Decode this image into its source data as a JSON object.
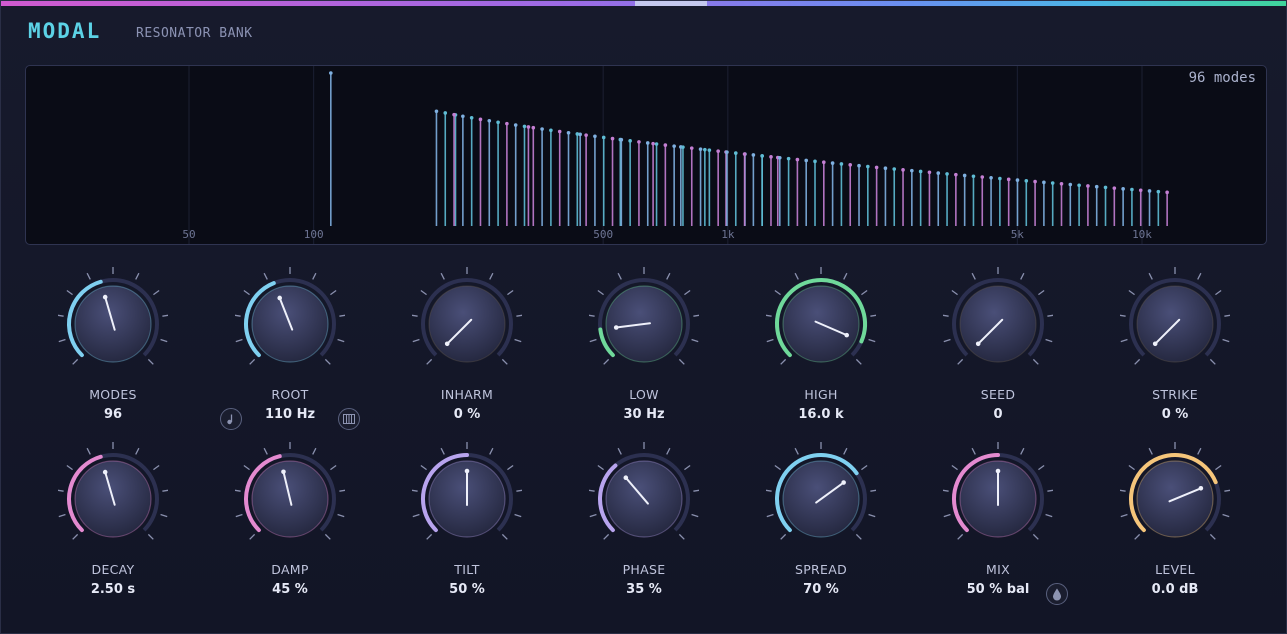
{
  "app": {
    "name": "MODAL",
    "subtitle": "RESONATOR BANK"
  },
  "display": {
    "mode_count_label": "96 modes"
  },
  "chart_data": {
    "type": "bar",
    "x_scale": "log",
    "x_ticks": [
      "50",
      "100",
      "500",
      "1k",
      "5k",
      "10k"
    ],
    "x_tick_values": [
      50,
      100,
      500,
      1000,
      5000,
      10000
    ],
    "xlim": [
      20,
      20000
    ],
    "mode_count": 96,
    "root_hz": 110,
    "upper_hz": 11500,
    "amplitudes": {
      "first": 1.0,
      "last": 0.22
    }
  },
  "colors": {
    "accent": "#5cd2e6",
    "mode_pink": "#c47fd3",
    "mode_blue": "#7fb0e0",
    "mode_cyan": "#5fbcd4",
    "knob_cyan": "#7fd0f0",
    "knob_pink": "#e48ad0",
    "knob_green": "#6fd99a",
    "knob_violet": "#b8a4ee",
    "knob_amber": "#f5c57a"
  },
  "knobs_row1": [
    {
      "id": "modes",
      "label": "MODES",
      "value": "96",
      "norm": 0.44,
      "arc": "#7fd0f0",
      "style": "dir"
    },
    {
      "id": "root",
      "label": "ROOT",
      "value": "110 Hz",
      "norm": 0.42,
      "arc": "#7fd0f0",
      "style": "dir"
    },
    {
      "id": "inharm",
      "label": "INHARM",
      "value": "0 %",
      "norm": 0.0,
      "arc": "none",
      "style": "dir"
    },
    {
      "id": "low",
      "label": "LOW",
      "value": "30 Hz",
      "norm": 0.14,
      "arc": "#6fd99a",
      "style": "dir"
    },
    {
      "id": "high",
      "label": "HIGH",
      "value": "16.0 k",
      "norm": 0.92,
      "arc": "#6fd99a",
      "style": "dir"
    },
    {
      "id": "seed",
      "label": "SEED",
      "value": "0",
      "norm": 0.0,
      "arc": "none",
      "style": "dir"
    },
    {
      "id": "strike",
      "label": "STRIKE",
      "value": "0 %",
      "norm": 0.0,
      "arc": "none",
      "style": "dir"
    }
  ],
  "knobs_row2": [
    {
      "id": "decay",
      "label": "DECAY",
      "value": "2.50 s",
      "norm": 0.44,
      "arc": "#e48ad0",
      "style": "dir"
    },
    {
      "id": "damp",
      "label": "DAMP",
      "value": "45 %",
      "norm": 0.45,
      "arc": "#e48ad0",
      "style": "dir"
    },
    {
      "id": "tilt",
      "label": "TILT",
      "value": "50 %",
      "norm": 0.5,
      "arc": "#b8a4ee",
      "style": "dir"
    },
    {
      "id": "phase",
      "label": "PHASE",
      "value": "35 %",
      "norm": 0.35,
      "arc": "#b8a4ee",
      "style": "dir"
    },
    {
      "id": "spread",
      "label": "SPREAD",
      "value": "70 %",
      "norm": 0.7,
      "arc": "#7fd0f0",
      "style": "dir"
    },
    {
      "id": "mix",
      "label": "MIX",
      "value": "50 % bal",
      "norm": 0.5,
      "arc": "#e48ad0",
      "style": "dir"
    },
    {
      "id": "level",
      "label": "LEVEL",
      "value": "0.0 dB",
      "norm": 0.75,
      "arc": "#f5c57a",
      "style": "dir"
    }
  ],
  "buttons": {
    "note_icon": "music-note-icon",
    "keyboard_icon": "piano-keyboard-icon",
    "drop_icon": "droplet-icon"
  }
}
